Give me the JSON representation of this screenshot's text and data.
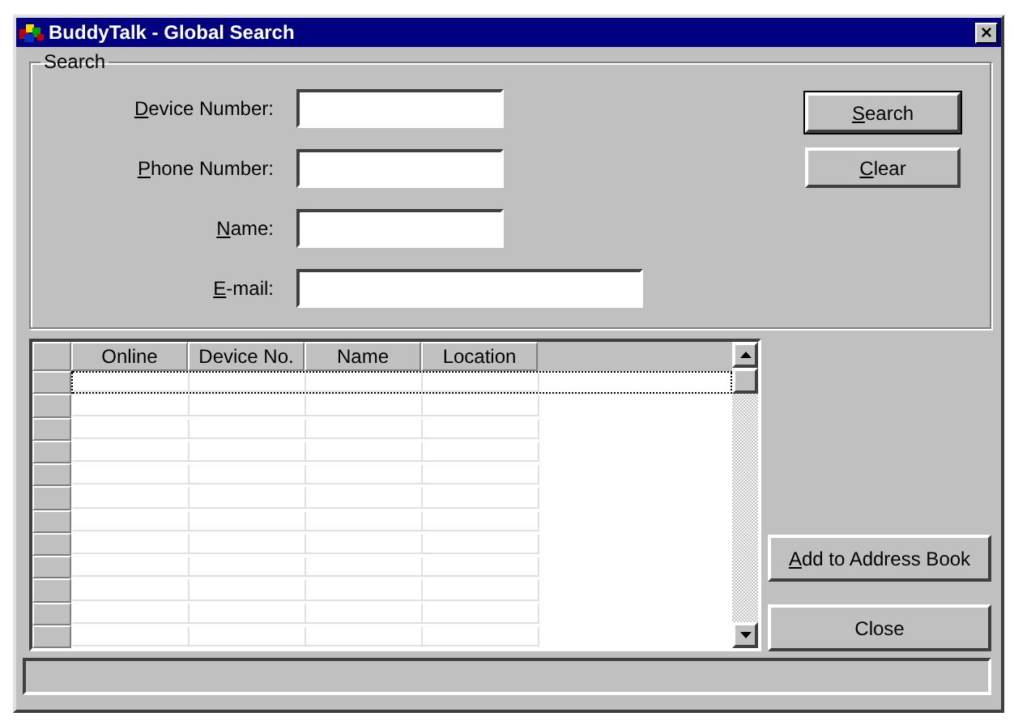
{
  "window": {
    "title": "BuddyTalk - Global Search",
    "close_glyph": "×"
  },
  "search_group": {
    "legend": "Search",
    "fields": [
      {
        "label": {
          "key": "D",
          "rest": "evice Number:"
        },
        "wide": false
      },
      {
        "label": {
          "key": "P",
          "rest": "hone Number:"
        },
        "wide": false
      },
      {
        "label": {
          "key": "N",
          "rest": "ame:"
        },
        "wide": false
      },
      {
        "label": {
          "key": "E",
          "rest": "-mail:"
        },
        "wide": true
      }
    ],
    "buttons": [
      {
        "label": {
          "key": "S",
          "rest": "earch"
        },
        "default": true
      },
      {
        "label": {
          "key": "C",
          "rest": "lear"
        },
        "default": false
      }
    ]
  },
  "table": {
    "columns": [
      "Online",
      "Device No.",
      "Name",
      "Location"
    ],
    "rows": [
      {
        "focused": true
      },
      {
        "focused": false
      },
      {
        "focused": false
      },
      {
        "focused": false
      },
      {
        "focused": false
      },
      {
        "focused": false
      },
      {
        "focused": false
      },
      {
        "focused": false
      },
      {
        "focused": false
      },
      {
        "focused": false
      },
      {
        "focused": false
      },
      {
        "focused": false
      }
    ]
  },
  "side_buttons": [
    {
      "label": {
        "key": "A",
        "rest": "dd to Address Book"
      }
    },
    {
      "label": {
        "rest": "Close"
      }
    }
  ]
}
